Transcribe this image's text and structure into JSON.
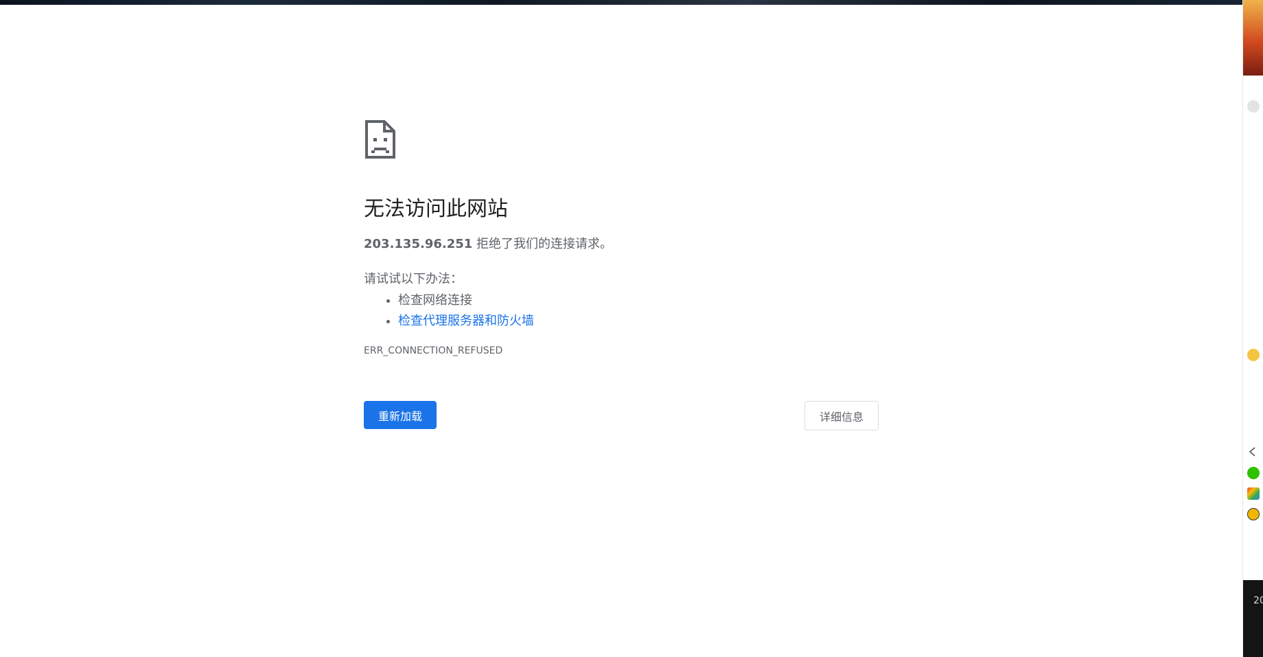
{
  "error_page": {
    "title": "无法访问此网站",
    "host": "203.135.96.251",
    "message_suffix": " 拒绝了我们的连接请求。",
    "try_heading": "请试试以下办法：",
    "suggestions": [
      {
        "label": "检查网络连接",
        "is_link": false
      },
      {
        "label": "检查代理服务器和防火墙",
        "is_link": true
      }
    ],
    "error_code": "ERR_CONNECTION_REFUSED",
    "reload_label": "重新加载",
    "details_label": "详细信息",
    "icon": "sad-page-icon"
  },
  "side_strip": {
    "clock_fragment": "20"
  },
  "colors": {
    "primary_button": "#1a73e8",
    "link": "#1a73e8",
    "title_text": "#202124",
    "body_text": "#5f6368"
  }
}
